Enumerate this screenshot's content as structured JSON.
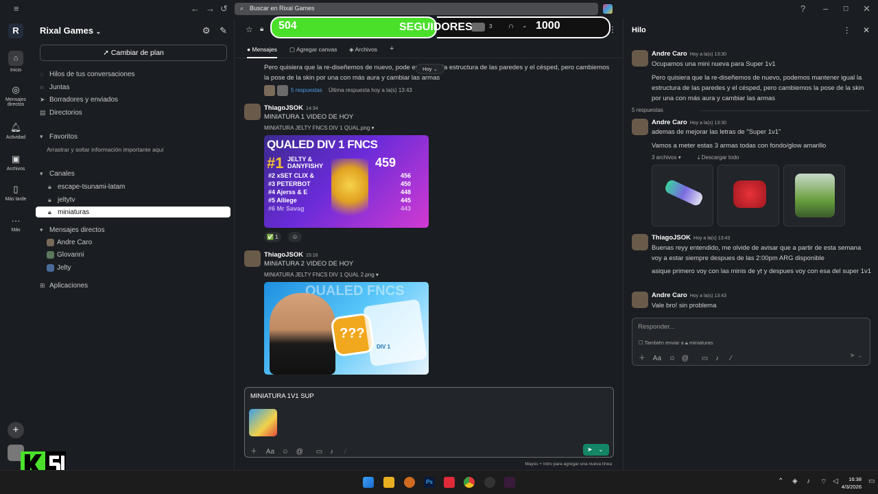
{
  "titlebar": {
    "search_placeholder": "Buscar en Rixal Games"
  },
  "rail": {
    "items": [
      {
        "label": "Inicio",
        "icon": "home-icon"
      },
      {
        "label": "Mensajes directos",
        "icon": "dm-icon"
      },
      {
        "label": "Actividad",
        "icon": "bell-icon"
      },
      {
        "label": "Archivos",
        "icon": "files-icon"
      },
      {
        "label": "Más tarde",
        "icon": "bookmark-icon"
      },
      {
        "label": "Más",
        "icon": "more-icon"
      }
    ],
    "logo": "R"
  },
  "sidebar": {
    "workspace": "Rixal Games",
    "plan_button": "Cambiar de plan",
    "nav": [
      "Hilos de tus conversaciones",
      "Juntas",
      "Borradores y enviados",
      "Directorios"
    ],
    "favorites_label": "Favoritos",
    "favorites_hint": "Arrastrar y soltar información importante aquí",
    "channels_label": "Canales",
    "channels": [
      "escape-tsunami-latam",
      "jeltytv",
      "miniaturas"
    ],
    "dm_label": "Mensajes directos",
    "dms": [
      "Andre Caro",
      "Glovanni",
      "Jelty"
    ],
    "apps_label": "Aplicaciones"
  },
  "overlay": {
    "left_count": "504",
    "label": "SEGUIDORES",
    "right_count": "1000",
    "members": "3"
  },
  "tabs": [
    "Mensajes",
    "Agregar canvas",
    "Archivos"
  ],
  "messages": {
    "hoy": "Hoy",
    "first_text": "Pero quisiera que la re-diseñemos de nuevo, pode      ener igual la estructura de las paredes y el césped, pero cambiemos la pose de la skin por una con más aura y cambiar las armas",
    "replies_link": "5 respuestas",
    "replies_meta": "Última respuesta hoy a la(s) 13:43",
    "m1": {
      "author": "ThiagoJSOK",
      "time": "14:34",
      "text": "MINIATURA 1 VIDEO DE HOY",
      "file": "MINIATURA JELTY FNCS DIV 1 QUAL.png",
      "reaction": "✅ 1"
    },
    "m2": {
      "author": "ThiagoJSOK",
      "time": "15:16",
      "text": "MINIATURA 2 VIDEO DE HOY",
      "file": "MINIATURA JELTY FNCS DIV 1 QUAL 2.png"
    },
    "thumb1": {
      "title": "QUALED DIV 1 FNCS",
      "rank1": "#1",
      "rank1_name": "JELTY & DANYFISHY",
      "rank1_score": "459",
      "rows": [
        {
          "rank": "#2",
          "name": "xSET CLIX &",
          "score": "456"
        },
        {
          "rank": "#3",
          "name": "PETERBOT",
          "score": "450"
        },
        {
          "rank": "#4",
          "name": "Ajerss & E",
          "score": "448"
        },
        {
          "rank": "#5",
          "name": "Alliege",
          "score": "445"
        },
        {
          "rank": "#6",
          "name": "Mr Savag",
          "score": "443"
        }
      ]
    },
    "thumb2": {
      "title": "QUALED FNCS",
      "badge": "???",
      "tag": "DIV 1"
    }
  },
  "composer": {
    "text": "MINIATURA 1V1 SUP",
    "hint": "Mayús + Intro para agregar una nueva línea"
  },
  "thread": {
    "title": "Hilo",
    "parent": {
      "author": "Andre Caro",
      "time": "Hoy a la(s) 13:30",
      "text1": "Ocupamos una mini nueva para Super 1v1",
      "text2": "Pero quisiera que la re-diseñemos de nuevo, podemos mantener igual la estructura de las paredes y el césped, pero cambiemos la pose de la skin por una con más aura y cambiar las armas"
    },
    "reply_count": "5 respuestas",
    "r1": {
      "author": "Andre Caro",
      "time": "Hoy a la(s) 13:30",
      "text1": "ademas de mejorar las letras de \"Super 1v1\"",
      "text2": "Vamos a meter estas 3 armas todas con fondo/glow amarillo",
      "files": "3 archivos",
      "download": "Descargar todo"
    },
    "r2": {
      "author": "ThiagoJSOK",
      "time": "Hoy a la(s) 13:43",
      "text1": "Buenas reyy entendido, me olvide de avisar que a partir de esta semana voy a estar siempre despues de las 2:00pm ARG disponible",
      "text2": "asique primero voy con las minis de yt y despues voy con esa del super 1v1"
    },
    "r3": {
      "author": "Andre Caro",
      "time": "Hoy a la(s) 13:43",
      "text": "Vale bro! sin problema"
    },
    "reply_placeholder": "Responder...",
    "also_send": "También enviar a",
    "also_channel": "miniaturas"
  },
  "taskbar": {
    "time": "16:38",
    "date": "4/3/2026"
  },
  "colors": {
    "accent_green": "#4ae02a",
    "send": "#148567"
  }
}
